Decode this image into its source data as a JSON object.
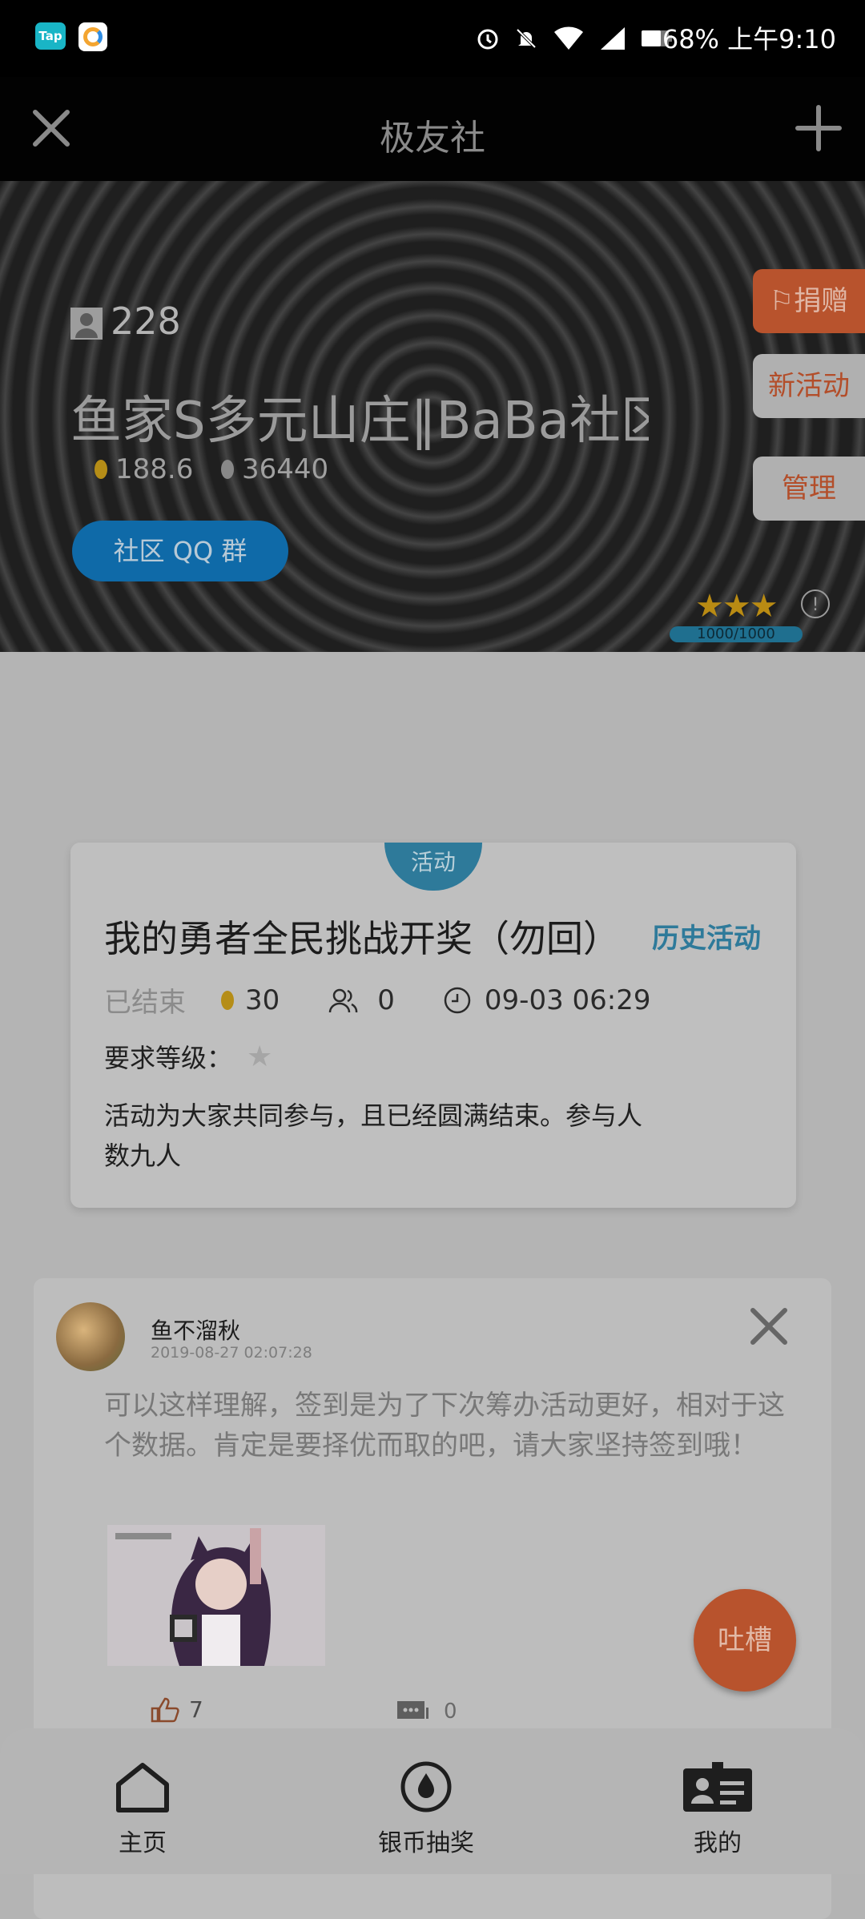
{
  "status_bar": {
    "tap_icon_label": "Tap",
    "battery": "68%",
    "time": "上午9:10"
  },
  "header": {
    "title": "极友社"
  },
  "community": {
    "member_count": "228",
    "name": "鱼家S多元山庄‖BaBa社区",
    "gold": "188.6",
    "silver": "36440",
    "qq_button": "社区 QQ 群",
    "donate": "捐赠",
    "new_activity": "新活动",
    "manage": "管理",
    "stars": "★★★",
    "level_progress_text": "1000/1000",
    "level_progress": 1.0,
    "info_icon": "!"
  },
  "activity": {
    "tag": "活动",
    "title": "我的勇者全民挑战开奖（勿回）",
    "history": "历史活动",
    "status": "已结束",
    "coins": "30",
    "participants": "0",
    "time": "09-03 06:29",
    "requirement_label": "要求等级：",
    "description": "活动为大家共同参与，且已经圆满结束。参与人数九人"
  },
  "comment": {
    "author": "鱼不溜秋",
    "date": "2019-08-27 02:07:28",
    "text": "可以这样理解，签到是为了下次筹办活动更好，相对于这个数据。肯定是要择优而取的吧，请大家坚持签到哦！",
    "likes": "7",
    "replies": "0"
  },
  "fab": {
    "label": "吐槽"
  },
  "bottom_nav": {
    "items": [
      {
        "label": "主页"
      },
      {
        "label": "银币抽奖"
      },
      {
        "label": "我的"
      }
    ]
  },
  "colors": {
    "accent_orange": "#b8532d",
    "accent_blue": "#2e7a9a",
    "qq_blue": "#0f6aa8",
    "gold": "#b58d17"
  }
}
